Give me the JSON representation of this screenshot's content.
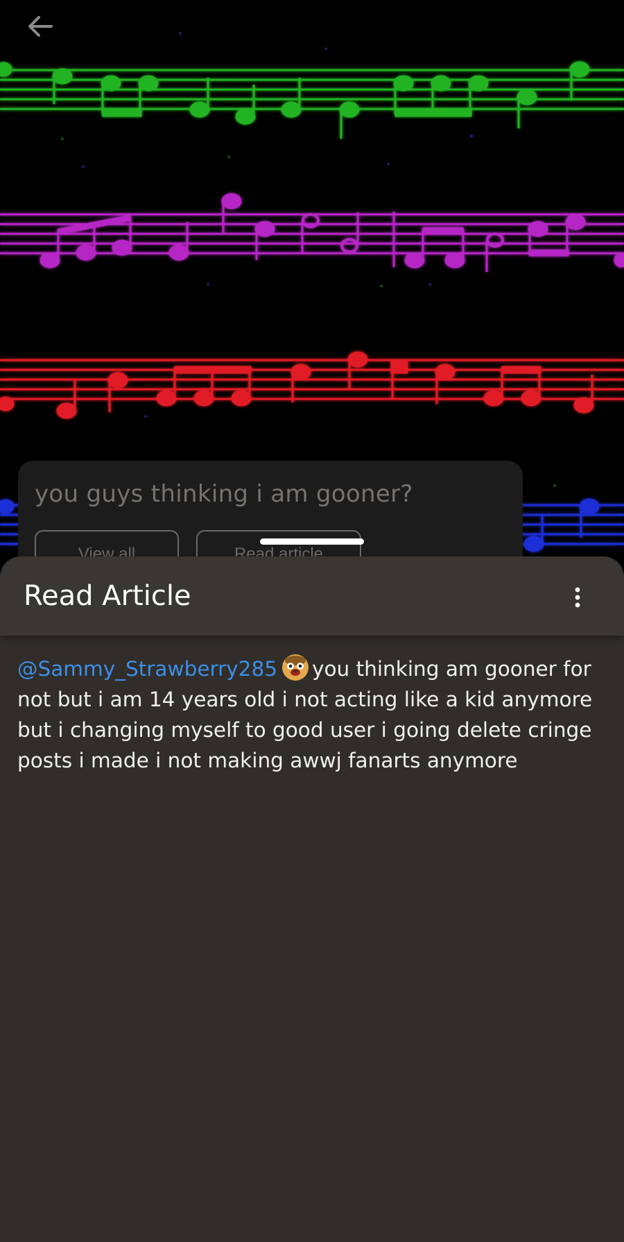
{
  "background": {
    "staff_colors": [
      "#22b322",
      "#b526c4",
      "#e21f26",
      "#1f2fd6"
    ]
  },
  "nav": {
    "back_icon": "arrow-left-icon"
  },
  "post_card": {
    "title": "you guys thinking i am gooner?",
    "buttons": [
      "View all",
      "Read article"
    ]
  },
  "sheet": {
    "title": "Read Article",
    "more_icon": "more-vertical-icon",
    "article": {
      "mention": "@Sammy_Strawberry285",
      "emoji_icon": "cartoon-face-emoji",
      "text": "you thinking am gooner for not but i am 14 years old i not acting like a kid anymore but i changing myself to good user i going delete cringe posts i made i not making awwj fanarts anymore"
    }
  }
}
